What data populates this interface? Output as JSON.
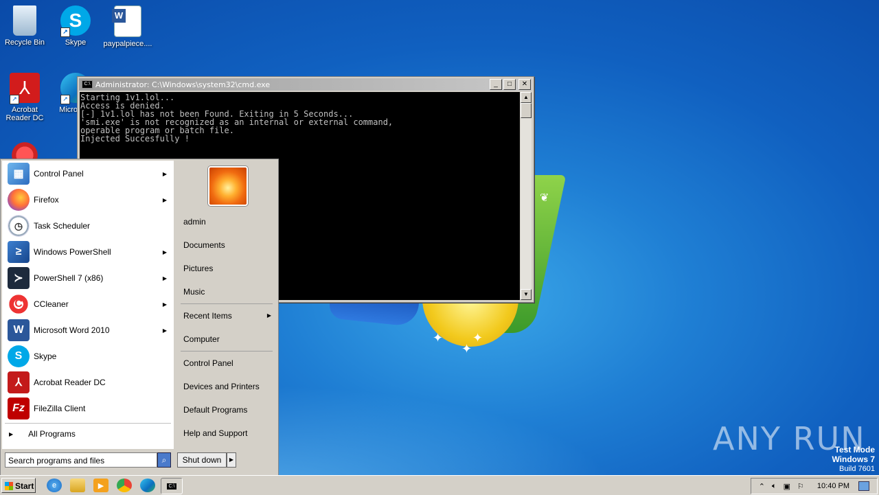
{
  "desktop": {
    "icons": [
      {
        "label": "Recycle Bin"
      },
      {
        "label": "Skype"
      },
      {
        "label": "paypalpiece...."
      },
      {
        "label": "Acrobat Reader DC"
      },
      {
        "label": "Microso..."
      },
      {
        "label": "CCleaner"
      }
    ]
  },
  "cmd_window": {
    "title": "Administrator: C:\\Windows\\system32\\cmd.exe",
    "output": "Starting 1v1.lol...\nAccess is denied.\n[-] 1v1.lol has not been Found. Exiting in 5 Seconds...\n'smi.exe' is not recognized as an internal or external command,\noperable program or batch file.\nInjected Succesfully !",
    "minimize_label": "_",
    "maximize_label": "□",
    "close_label": "✕"
  },
  "start_menu": {
    "programs": [
      {
        "label": "Control Panel",
        "icon": "control-panel-icon",
        "has_submenu": true
      },
      {
        "label": "Firefox",
        "icon": "firefox-icon",
        "has_submenu": true
      },
      {
        "label": "Task Scheduler",
        "icon": "clock-icon",
        "has_submenu": false
      },
      {
        "label": "Windows PowerShell",
        "icon": "powershell-icon",
        "has_submenu": true
      },
      {
        "label": "PowerShell 7 (x86)",
        "icon": "powershell7-icon",
        "has_submenu": true
      },
      {
        "label": "CCleaner",
        "icon": "ccleaner-icon",
        "has_submenu": true
      },
      {
        "label": "Microsoft Word 2010",
        "icon": "word-icon",
        "has_submenu": true
      },
      {
        "label": "Skype",
        "icon": "skype-icon",
        "has_submenu": false
      },
      {
        "label": "Acrobat Reader DC",
        "icon": "acrobat-icon",
        "has_submenu": false
      },
      {
        "label": "FileZilla Client",
        "icon": "filezilla-icon",
        "has_submenu": false
      }
    ],
    "all_programs": "All Programs",
    "search_placeholder": "Search programs and files",
    "right_items": [
      "admin",
      "Documents",
      "Pictures",
      "Music"
    ],
    "right_items_2": [
      "Recent Items",
      "Computer"
    ],
    "right_items_3": [
      "Control Panel",
      "Devices and Printers",
      "Default Programs",
      "Help and Support"
    ],
    "shutdown_label": "Shut down"
  },
  "taskbar": {
    "start_label": "Start",
    "clock": "10:40 PM"
  },
  "watermark": {
    "brand": "ANY RUN",
    "line1": "Test Mode",
    "line2": "Windows 7",
    "line3": "Build 7601"
  }
}
